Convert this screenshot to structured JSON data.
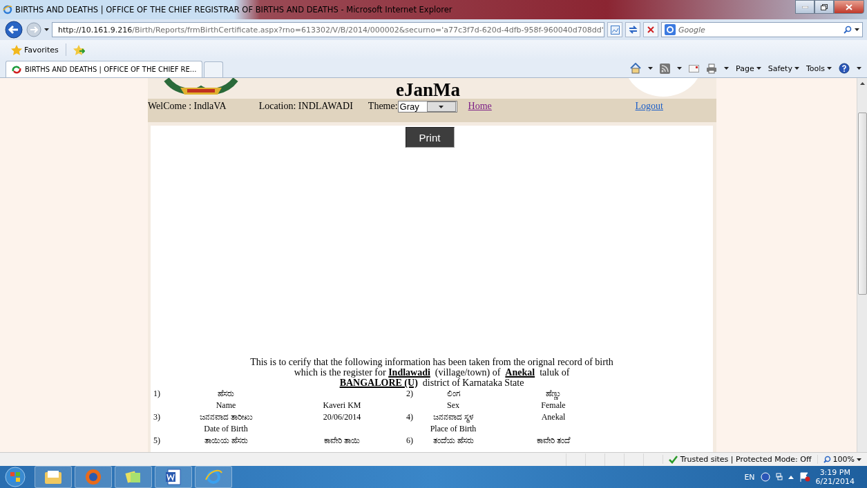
{
  "window": {
    "title": "BIRTHS AND DEATHS | OFFICE OF THE CHIEF REGISTRAR OF BIRTHS AND DEATHS - Microsoft Internet Explorer",
    "url_host": "http://10.161.9.216",
    "url_path": "/Birth/Reports/frmBirthCertificate.aspx?rno=613302/V/B/2014/000002&securno='a77c3f7d-620d-4dfb-958f-960040d708dd'",
    "search_placeholder": "Google"
  },
  "favorites": {
    "label": "Favorites"
  },
  "tabs": [
    {
      "label": "BIRTHS AND DEATHS | OFFICE OF THE CHIEF RE...",
      "selected": true
    }
  ],
  "command_bar": [
    "Page",
    "Safety",
    "Tools"
  ],
  "page": {
    "site_title": "eJanMa",
    "nav": {
      "welcome": "WelCome : IndlaVA",
      "location": "Location: INDLAWADI",
      "theme_label": "Theme:",
      "theme_value": "Gray",
      "home": "Home",
      "logout": "Logout"
    },
    "print_button": "Print",
    "certificate": {
      "intro_lines": [
        "This is to cerify that the following information has been taken from the orignal record of birth",
        "which is the register for **Indlawadi**  (village/town) of  **Anekal**  taluk of",
        "**BANGALORE (U)**  district of Karnataka State"
      ],
      "rows": [
        {
          "left": {
            "number": "1)",
            "label_kn": "ಹೆಸರು",
            "label_en": "Name",
            "value_bottom": "Kaveri KM"
          },
          "right": {
            "number": "2)",
            "label_kn": "ಲಿಂಗ",
            "label_en": "Sex",
            "value_top": "ಹೆಣ್ಣು",
            "value_bottom": "Female"
          }
        },
        {
          "left": {
            "number": "3)",
            "label_kn": "ಜನನವಾದ ತಾರೀಖು",
            "label_en": "Date of Birth",
            "value_top": "20/06/2014"
          },
          "right": {
            "number": "4)",
            "label_kn": "ಜನನವಾದ ಸ್ಥಳ",
            "label_en": "Place of Birth",
            "value_top": "Anekal"
          }
        },
        {
          "left": {
            "number": "5)",
            "label_kn": "ತಾಯಿಯ ಹೆಸರು",
            "value_top": "ಕಾವೇರಿ ತಾಯಿ"
          },
          "right": {
            "number": "6)",
            "label_kn": "ತಂದೆಯ ಹೆಸರು",
            "value_top": "ಕಾವೇರಿ ತಂದೆ"
          }
        }
      ]
    }
  },
  "status_bar": {
    "zone": "Trusted sites | Protected Mode: Off",
    "zoom": "100%"
  },
  "taskbar": {
    "language": "EN",
    "time": "3:19 PM",
    "date": "6/21/2014"
  }
}
